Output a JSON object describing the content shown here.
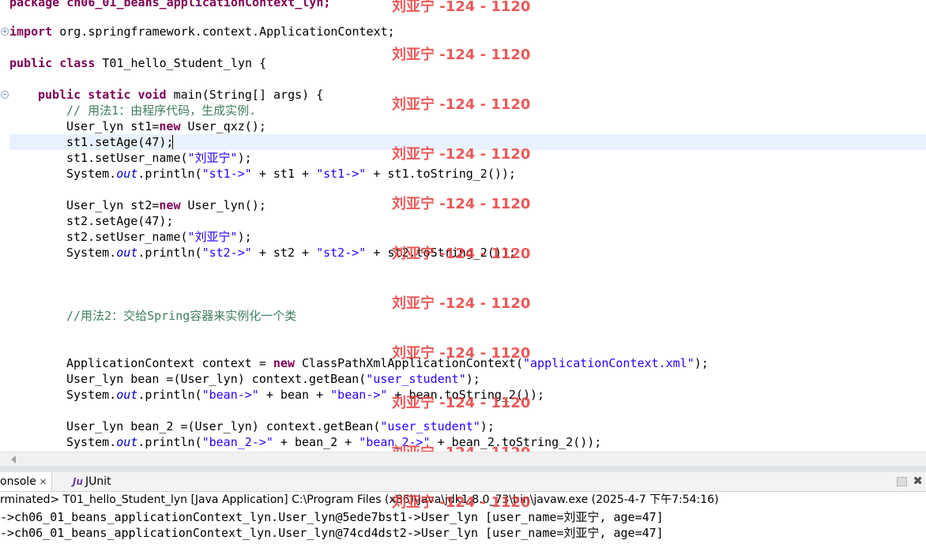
{
  "editor": {
    "lines": {
      "package_line": "package ch06_01_beans_applicationContext_lyn;",
      "import_kw": "import",
      "import_rest": " org.springframework.context.ApplicationContext;",
      "class_kw1": "public",
      "class_kw2": "class",
      "class_rest": " T01_hello_Student_lyn {",
      "main_kw1": "public",
      "main_kw2": "static",
      "main_kw3": "void",
      "main_rest": " main(String[] args) {",
      "comment1": "// 用法1：由程序代码，生成实例.",
      "l6_a": "User_lyn st1=",
      "l6_kw": "new",
      "l6_b": " User_qxz();",
      "l7": "st1.setAge(47);",
      "l8_a": "st1.setUser_name(",
      "l8_str": "\"刘亚宁\"",
      "l8_b": ");",
      "l9_a": "System.",
      "l9_out": "out",
      "l9_b": ".println(",
      "l9_s1": "\"st1->\"",
      "l9_c": " + st1 + ",
      "l9_s2": "\"st1->\"",
      "l9_d": " + st1.toString_2());",
      "l11_a": "User_lyn st2=",
      "l11_kw": "new",
      "l11_b": " User_lyn();",
      "l12": "st2.setAge(47);",
      "l13_a": "st2.setUser_name(",
      "l13_str": "\"刘亚宁\"",
      "l13_b": ");",
      "l14_a": "System.",
      "l14_out": "out",
      "l14_b": ".println(",
      "l14_s1": "\"st2->\"",
      "l14_c": " + st2 + ",
      "l14_s2": "\"st2->\"",
      "l14_d": " + st2.toString_2());",
      "comment2": "//用法2：交给Spring容器来实例化一个类",
      "l20_a": "ApplicationContext context = ",
      "l20_kw": "new",
      "l20_b": " ClassPathXmlApplicationContext(",
      "l20_str": "\"applicationContext.xml\"",
      "l20_c": ");",
      "l21_a": "User_lyn bean =(User_lyn) context.getBean(",
      "l21_str": "\"user_student\"",
      "l21_b": ");",
      "l22_a": "System.",
      "l22_out": "out",
      "l22_b": ".println(",
      "l22_s1": "\"bean->\"",
      "l22_c": " + bean + ",
      "l22_s2": "\"bean->\"",
      "l22_d": " + bean.toString_2());",
      "l24_a": "User_lyn bean_2 =(User_lyn) context.getBean(",
      "l24_str": "\"user_student\"",
      "l24_b": ");",
      "l25_a": "System.",
      "l25_out": "out",
      "l25_b": ".println(",
      "l25_s1": "\"bean_2->\"",
      "l25_c": " + bean_2 + ",
      "l25_s2": "\"bean_2->\"",
      "l25_d": " + bean_2.toString_2());"
    },
    "watermark": "刘亚宁 -124 - 1120"
  },
  "console": {
    "tab_console": "onsole",
    "tab_junit_icon": "Ju",
    "tab_junit": "JUnit",
    "status": "rminated> T01_hello_Student_lyn [Java Application] C:\\Program Files (x86)\\Java\\jdk1.8.0_73\\bin\\javaw.exe (2025-4-7 下午7:54:16)",
    "output": [
      "->ch06_01_beans_applicationContext_lyn.User_lyn@5ede7bst1->User_lyn [user_name=刘亚宁, age=47]",
      "->ch06_01_beans_applicationContext_lyn.User_lyn@74cd4dst2->User_lyn [user_name=刘亚宁, age=47]"
    ]
  },
  "colors": {
    "keyword": "#7f0055",
    "string": "#2a00ff",
    "comment": "#3f7f5f",
    "static_field": "#0000c0",
    "current_line": "#e8f2fe",
    "watermark": "#e63c3c"
  }
}
